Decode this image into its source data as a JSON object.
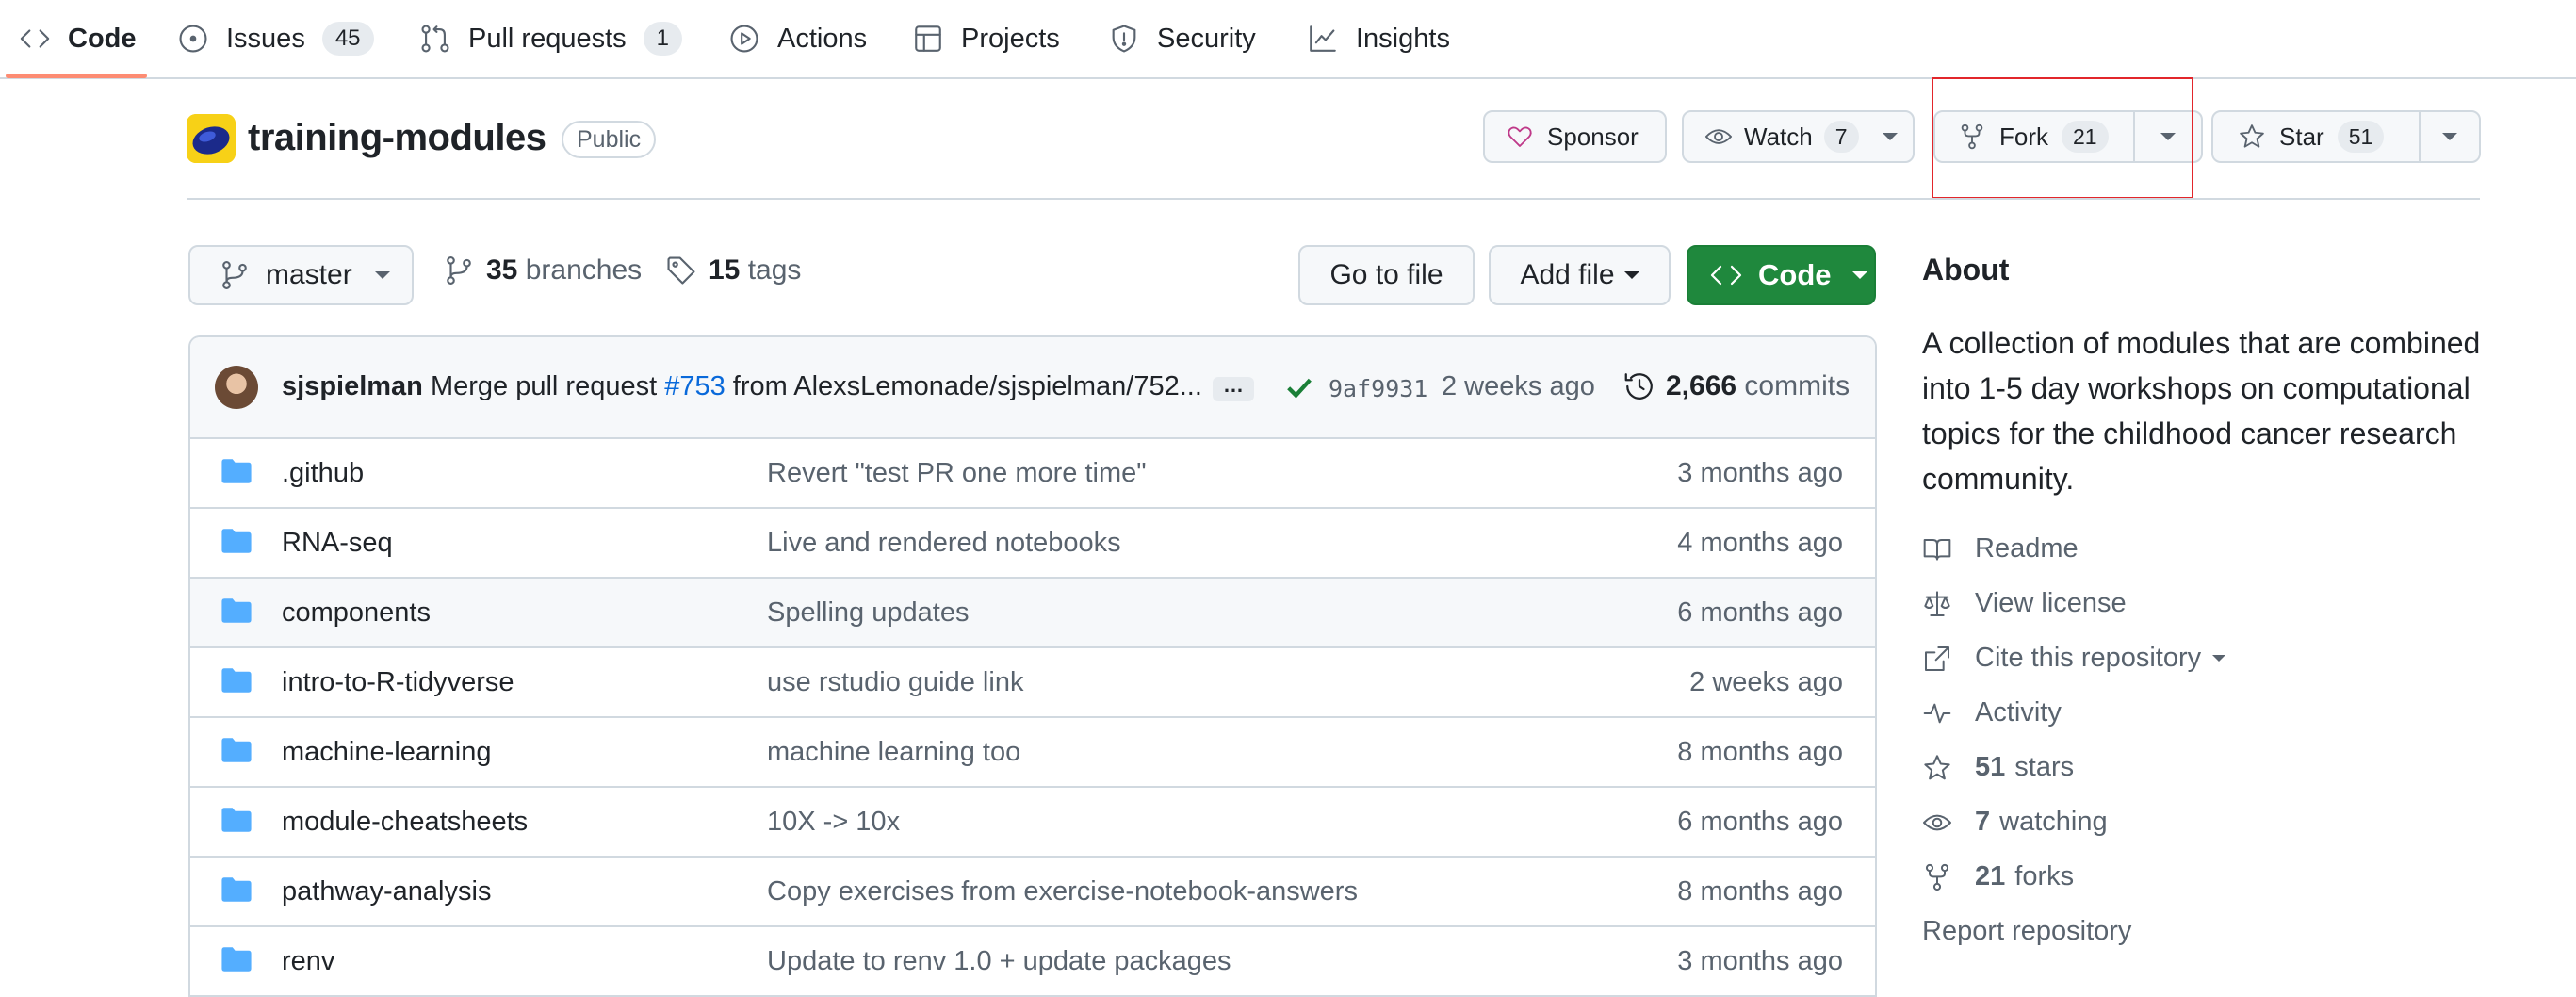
{
  "nav": {
    "tabs": [
      {
        "label": "Code",
        "icon": "code-icon"
      },
      {
        "label": "Issues",
        "count": "45",
        "icon": "issue-opened-icon"
      },
      {
        "label": "Pull requests",
        "count": "1",
        "icon": "git-pull-request-icon"
      },
      {
        "label": "Actions",
        "icon": "play-icon"
      },
      {
        "label": "Projects",
        "icon": "table-icon"
      },
      {
        "label": "Security",
        "icon": "shield-icon"
      },
      {
        "label": "Insights",
        "icon": "graph-icon"
      }
    ],
    "selected": "Code",
    "selected_underline_color": "#fd8c73"
  },
  "repo": {
    "name": "training-modules",
    "visibility": "Public",
    "sponsor_label": "Sponsor",
    "watch_label": "Watch",
    "watch_count": "7",
    "fork_label": "Fork",
    "fork_count": "21",
    "star_label": "Star",
    "star_count": "51"
  },
  "branch_bar": {
    "branch": "master",
    "branches_count": "35",
    "branches_label": "branches",
    "tags_count": "15",
    "tags_label": "tags",
    "go_to_file": "Go to file",
    "add_file": "Add file",
    "code_button": "Code",
    "code_button_color": "#1f883d"
  },
  "latest_commit": {
    "author": "sjspielman",
    "message_prefix": "Merge pull request",
    "pr_number": "#753",
    "message_suffix": "from AlexsLemonade/sjspielman/752...",
    "ellipsis": "…",
    "sha": "9af9931",
    "time": "2 weeks ago",
    "commits_count": "2,666",
    "commits_label": "commits",
    "link_color": "#0969da"
  },
  "files": [
    {
      "name": ".github",
      "message": "Revert \"test PR one more time\"",
      "age": "3 months ago"
    },
    {
      "name": "RNA-seq",
      "message": "Live and rendered notebooks",
      "age": "4 months ago"
    },
    {
      "name": "components",
      "message": "Spelling updates",
      "age": "6 months ago"
    },
    {
      "name": "intro-to-R-tidyverse",
      "message": "use rstudio guide link",
      "age": "2 weeks ago"
    },
    {
      "name": "machine-learning",
      "message": "machine learning too",
      "age": "8 months ago"
    },
    {
      "name": "module-cheatsheets",
      "message": "10X -> 10x",
      "age": "6 months ago"
    },
    {
      "name": "pathway-analysis",
      "message": "Copy exercises from exercise-notebook-answers",
      "age": "8 months ago"
    },
    {
      "name": "renv",
      "message": "Update to renv 1.0 + update packages",
      "age": "3 months ago"
    }
  ],
  "about": {
    "title": "About",
    "description": "A collection of modules that are combined into 1-5 day workshops on computational topics for the childhood cancer research community.",
    "readme": "Readme",
    "license": "View license",
    "cite": "Cite this repository",
    "activity": "Activity",
    "stars_count": "51",
    "stars_label": "stars",
    "watching_count": "7",
    "watching_label": "watching",
    "forks_count": "21",
    "forks_label": "forks",
    "report": "Report repository"
  },
  "colors": {
    "folder": "#54aeff",
    "highlight_box": "#e2262b",
    "border": "#d1d9e0",
    "muted_text": "#59636e"
  }
}
